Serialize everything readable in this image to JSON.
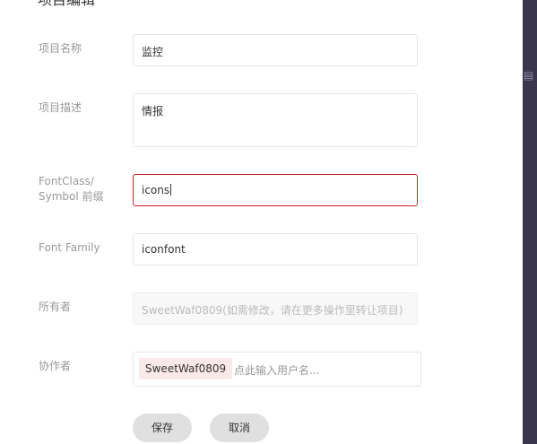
{
  "dialog": {
    "title": "项目编辑"
  },
  "form": {
    "name": {
      "label": "项目名称",
      "value": "监控"
    },
    "description": {
      "label": "项目描述",
      "value": "情报"
    },
    "prefix": {
      "label_line1": "FontClass/",
      "label_line2": "Symbol 前缀",
      "value": "icons"
    },
    "font_family": {
      "label": "Font Family",
      "value": "iconfont"
    },
    "owner": {
      "label": "所有者",
      "value": "SweetWaf0809(如需修改，请在更多操作里转让项目)"
    },
    "collaborators": {
      "label": "协作者",
      "tags": [
        "SweetWaf0809"
      ],
      "input_placeholder": "点此输入用户名..."
    }
  },
  "buttons": {
    "save": "保存",
    "cancel": "取消"
  },
  "colors": {
    "focus_border": "#c81e2b",
    "tag_background": "#fbe8e8",
    "side_bar": "#39364e",
    "button_background": "#e0e0e0"
  }
}
